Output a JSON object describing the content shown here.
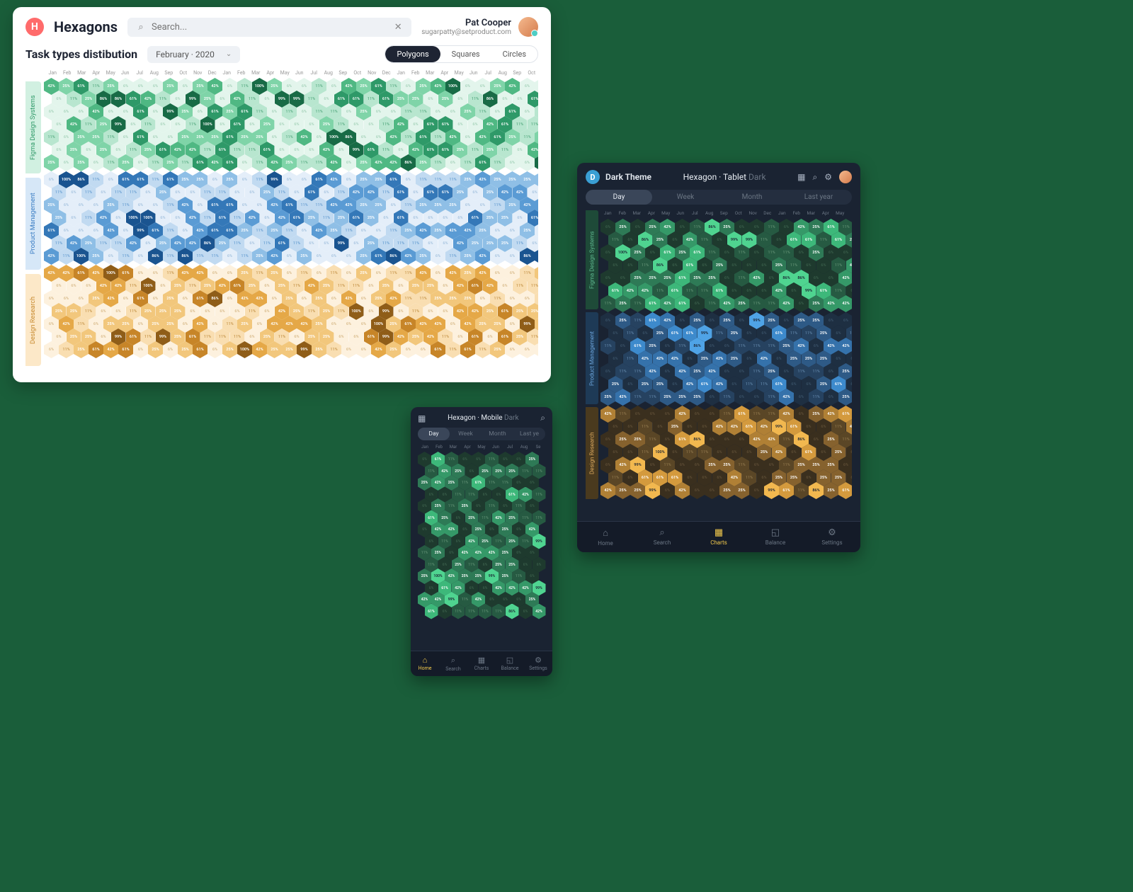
{
  "desktop": {
    "logo": "H",
    "brand": "Hexagons",
    "search_placeholder": "Search...",
    "user": {
      "name": "Pat Cooper",
      "email": "sugarpatty@setproduct.com"
    },
    "title": "Task types distibution",
    "month_selector": "February · 2020",
    "segments": [
      "Polygons",
      "Squares",
      "Circles"
    ],
    "months": [
      "Jan",
      "Feb",
      "Mar",
      "Apr",
      "May",
      "Jun",
      "Jul",
      "Aug",
      "Sep",
      "Oct",
      "Nov",
      "Dec",
      "Jan",
      "Feb",
      "Mar",
      "Apr",
      "May",
      "Jun",
      "Jul",
      "Aug",
      "Sep",
      "Oct",
      "Nov",
      "Dec",
      "Jan",
      "Feb",
      "Mar",
      "Apr",
      "May",
      "Jun",
      "Jul",
      "Aug",
      "Sep",
      "Oct"
    ],
    "categories": [
      "Figma Design Systems",
      "Product Management",
      "Design Research"
    ]
  },
  "tablet": {
    "logo": "D",
    "brand": "Dark Theme",
    "title_main": "Hexagon · Tablet",
    "title_dim": "Dark",
    "segments": [
      "Day",
      "Week",
      "Month",
      "Last year"
    ],
    "months": [
      "Jan",
      "Feb",
      "Mar",
      "Apr",
      "May",
      "Jun",
      "Jul",
      "Aug",
      "Sep",
      "Oct",
      "Nov",
      "Dec",
      "Jan",
      "Feb",
      "Mar",
      "Apr",
      "May"
    ],
    "categories": [
      "Figma Design Systems",
      "Product Management",
      "Design Research"
    ],
    "nav": [
      "Home",
      "Search",
      "Charts",
      "Balance",
      "Settings"
    ]
  },
  "mobile": {
    "title_main": "Hexagon · Mobile",
    "title_dim": "Dark",
    "segments": [
      "Day",
      "Week",
      "Month",
      "Last ye"
    ],
    "months": [
      "Jan",
      "Feb",
      "Mar",
      "Apr",
      "May",
      "Jun",
      "Jul",
      "Aug",
      "Se"
    ],
    "nav": [
      "Home",
      "Search",
      "Charts",
      "Balance",
      "Settings"
    ]
  },
  "chart_data": {
    "type": "heatmap",
    "note": "Hexagonal heatmap. Cells show percentage values. Shade intensity 0-5 maps to value bins.",
    "value_labels": [
      "6%",
      "11%",
      "25%",
      "42%",
      "61%",
      "86%",
      "99%",
      "100%"
    ],
    "series": [
      {
        "name": "Figma Design Systems",
        "color_scheme": "green"
      },
      {
        "name": "Product Management",
        "color_scheme": "blue"
      },
      {
        "name": "Design Research",
        "color_scheme": "orange"
      }
    ]
  }
}
